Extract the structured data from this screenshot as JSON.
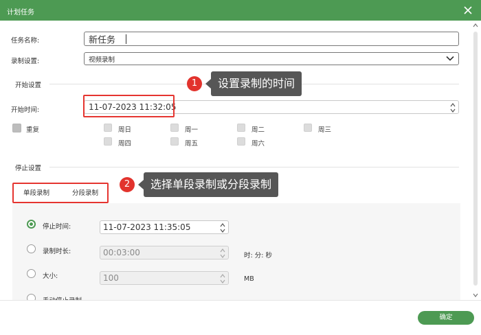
{
  "window": {
    "title": "计划任务",
    "close_icon": "close-icon"
  },
  "task": {
    "name_label": "任务名称:",
    "name_value": "新任务",
    "record_label": "录制设置:",
    "record_value": "视频录制"
  },
  "start": {
    "section_title": "开始设置",
    "time_label": "开始时间:",
    "time_value": "11-07-2023 11:32:05",
    "repeat_label": "重复",
    "days_row1": [
      "周日",
      "周一",
      "周二",
      "周三"
    ],
    "days_row2": [
      "周四",
      "周五",
      "周六"
    ]
  },
  "stop": {
    "section_title": "停止设置",
    "tabs": [
      "单段录制",
      "分段录制"
    ],
    "stop_time_label": "停止时间:",
    "stop_time_value": "11-07-2023 11:35:05",
    "duration_label": "录制时长:",
    "duration_value": "00:03:00",
    "duration_unit": "时: 分: 秒",
    "size_label": "大小:",
    "size_value": "100",
    "size_unit": "MB",
    "manual_label": "手动停止录制",
    "selected_option": "stop_time"
  },
  "annotations": [
    {
      "number": "1",
      "text": "设置录制的时间"
    },
    {
      "number": "2",
      "text": "选择单段录制或分段录制"
    }
  ],
  "footer": {
    "confirm_label": "确定"
  },
  "colors": {
    "accent": "#4d9a53",
    "highlight": "#e5342f",
    "callout_bg": "#565656"
  }
}
